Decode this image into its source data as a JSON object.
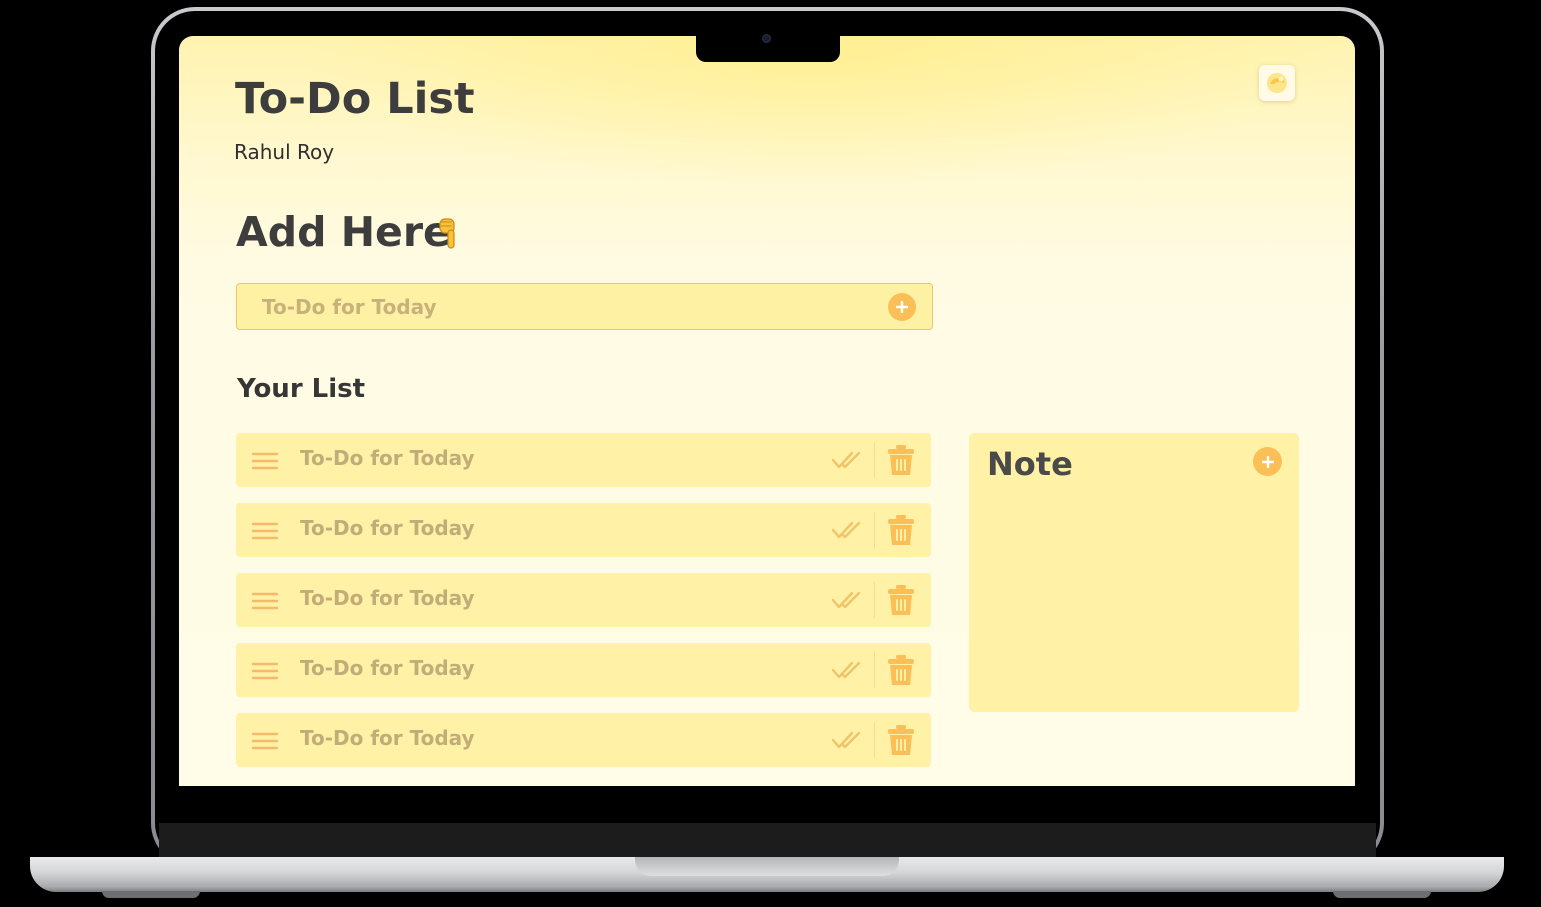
{
  "app": {
    "title": "To-Do List",
    "author": "Rahul Roy"
  },
  "add_section": {
    "heading": "Add Here",
    "input_placeholder": "To-Do for Today"
  },
  "list_section": {
    "heading": "Your List",
    "items": [
      {
        "text": "To-Do for Today"
      },
      {
        "text": "To-Do for Today"
      },
      {
        "text": "To-Do for Today"
      },
      {
        "text": "To-Do for Today"
      },
      {
        "text": "To-Do for Today"
      }
    ]
  },
  "note": {
    "title": "Note"
  },
  "icons": {
    "theme": "theme-toggle-icon",
    "pointer": "pointing-down-hand-icon",
    "add": "plus-icon",
    "drag": "hamburger-icon",
    "done": "double-check-icon",
    "delete": "trash-icon"
  },
  "colors": {
    "accent": "#fbbf58",
    "card": "#fff1a6",
    "background": "#fffce8",
    "heading_text": "#3d3d3d",
    "muted_text": "#c2ad78"
  }
}
